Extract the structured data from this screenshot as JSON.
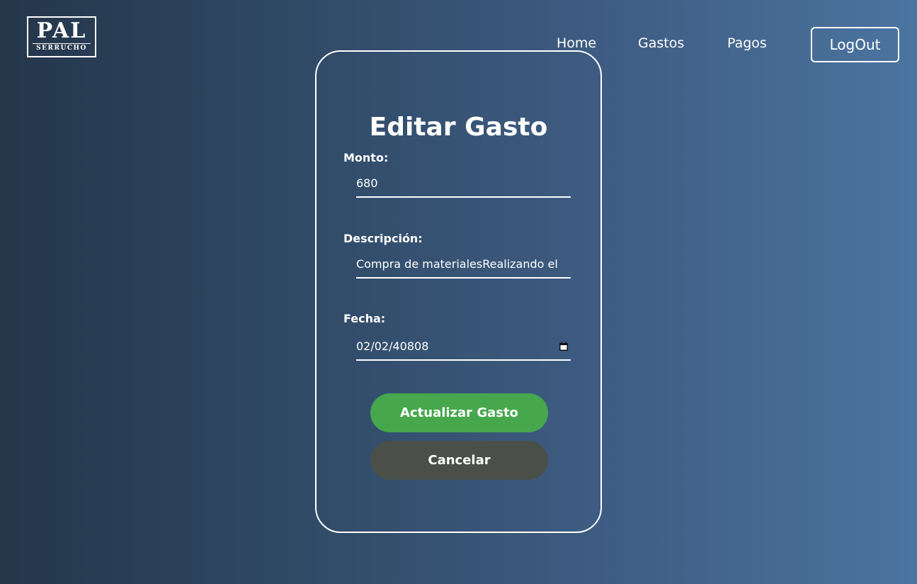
{
  "logo": {
    "main": "PAL",
    "sub": "SERRUCHO"
  },
  "nav": {
    "items": [
      {
        "label": "Home"
      },
      {
        "label": "Gastos"
      },
      {
        "label": "Pagos"
      }
    ],
    "logout_label": "LogOut"
  },
  "form": {
    "title": "Editar Gasto",
    "monto": {
      "label": "Monto:",
      "value": "680"
    },
    "descripcion": {
      "label": "Descripción:",
      "value": "Compra de materialesRealizando el"
    },
    "fecha": {
      "label": "Fecha:",
      "value": "02/02/40808"
    },
    "update_label": "Actualizar Gasto",
    "cancel_label": "Cancelar"
  },
  "icons": {
    "calendar": "calendar-icon"
  },
  "colors": {
    "update_button": "#46a74d",
    "cancel_button": "#4a5049",
    "text": "#ffffff"
  }
}
